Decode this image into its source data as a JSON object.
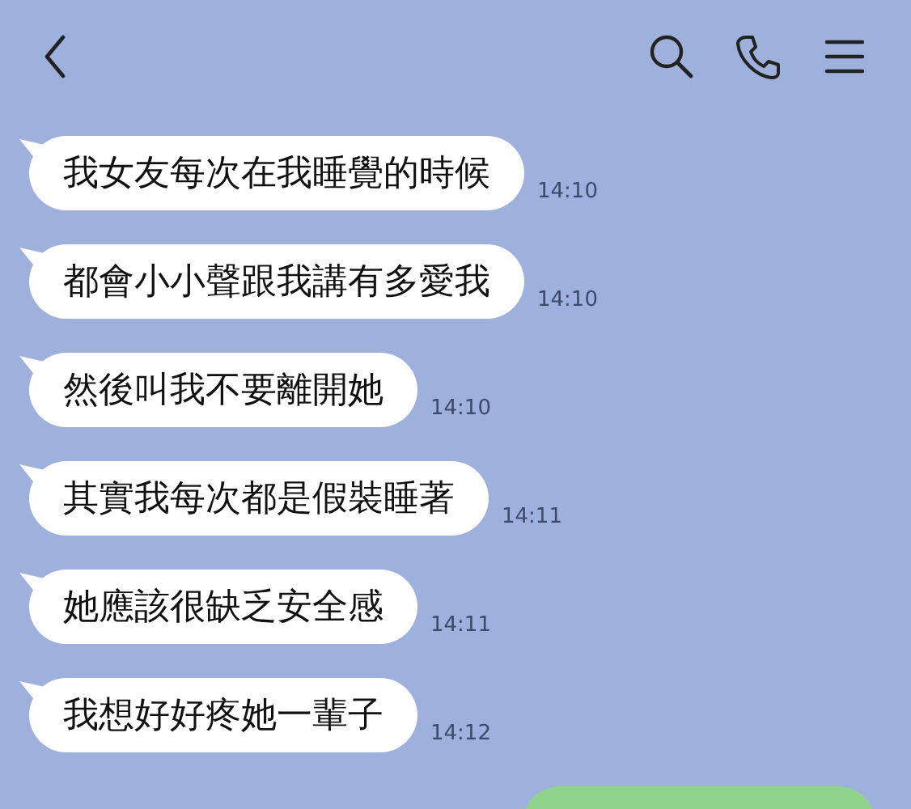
{
  "messages": [
    {
      "kind": "incoming",
      "text": "我女友每次在我睡覺的時候",
      "time": "14:10"
    },
    {
      "kind": "incoming",
      "text": "都會小小聲跟我講有多愛我",
      "time": "14:10"
    },
    {
      "kind": "incoming",
      "text": "然後叫我不要離開她",
      "time": "14:10"
    },
    {
      "kind": "incoming",
      "text": "其實我每次都是假裝睡著",
      "time": "14:11"
    },
    {
      "kind": "incoming",
      "text": "她應該很缺乏安全感",
      "time": "14:11"
    },
    {
      "kind": "incoming",
      "text": "我想好好疼她一輩子",
      "time": "14:12"
    },
    {
      "kind": "outgoing"
    }
  ]
}
